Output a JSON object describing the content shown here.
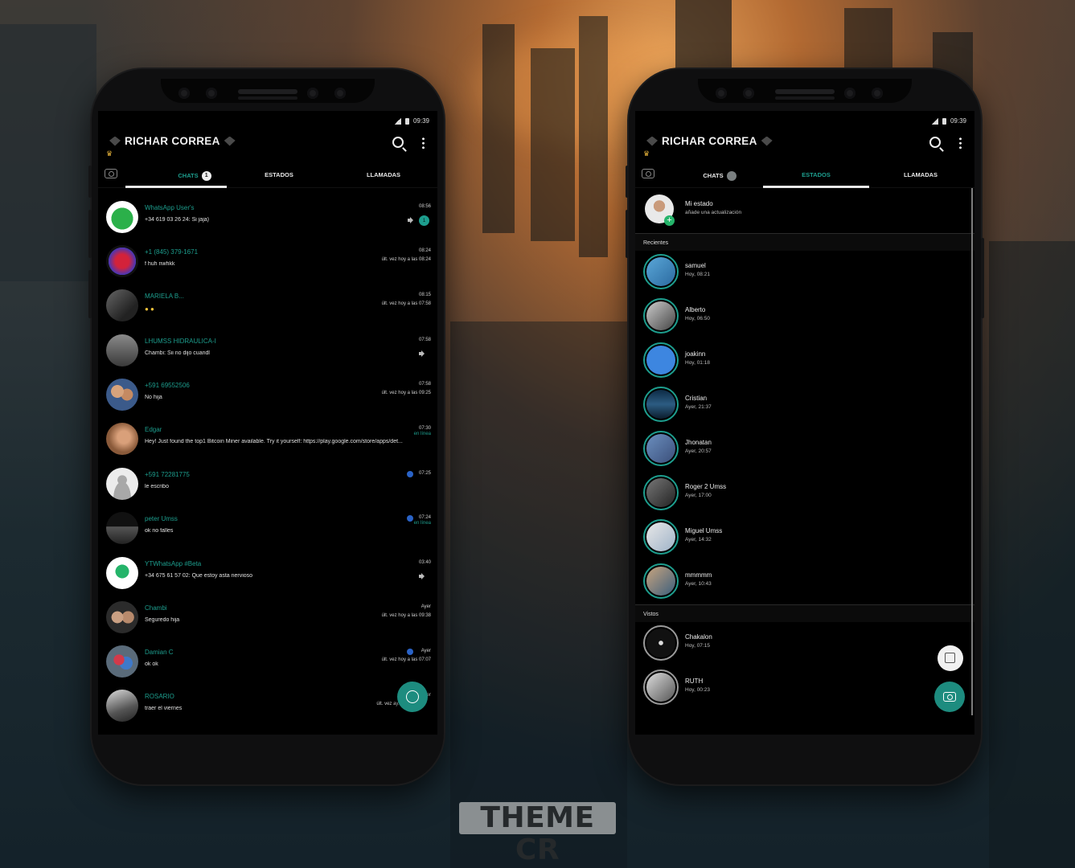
{
  "brand": {
    "logo_text": "THEME CR"
  },
  "phones": [
    {
      "status": {
        "time": "09:39"
      },
      "header": {
        "title": "RICHAR CORREA"
      },
      "tabs": [
        {
          "label": "CHATS",
          "badge": "1"
        },
        {
          "label": "ESTADOS"
        },
        {
          "label": "LLAMADAS"
        }
      ],
      "chats": [
        {
          "name": "WhatsApp User's",
          "msg": "+34 619 03 26 24: Si jaja)",
          "time": "08:56",
          "sub": "",
          "unread": "1"
        },
        {
          "name": "+1 (845) 379-1671",
          "msg": "f huh nwhkk",
          "time": "08:24",
          "sub": "últ. vez hoy a las 08:24"
        },
        {
          "name": "MARIELA B...",
          "msg": "",
          "time": "08:15",
          "sub": "últ. vez hoy a las 07:58"
        },
        {
          "name": "LHUMSS HIDRAULICA-I",
          "msg": "Chambi: Sii no dijo cuandl",
          "time": "07:58",
          "sub": ""
        },
        {
          "name": "+591 69552506",
          "msg": "No hija",
          "time": "07:58",
          "sub": "últ. vez hoy a las 09:25"
        },
        {
          "name": "Edgar",
          "msg": "Hey! Just found the top1 Bitcoin Miner available. Try it yourself: https://play.google.com/store/apps/det...",
          "time": "07:30",
          "sub": "en línea"
        },
        {
          "name": "+591 72281775",
          "msg": "le escribo",
          "time": "07:25",
          "sub": ""
        },
        {
          "name": "peter Umss",
          "msg": "ok no falles",
          "time": "07:24",
          "sub": "en línea"
        },
        {
          "name": "YTWhatsApp #Beta",
          "msg": "+34 675 61 57 02: Que estoy asta nervioso",
          "time": "03:40",
          "sub": ""
        },
        {
          "name": "Chambi",
          "msg": "Seguredo hija",
          "time": "Ayer",
          "sub": "últ. vez hoy a las 09:38"
        },
        {
          "name": "Damian C",
          "msg": "ok ok",
          "time": "Ayer",
          "sub": "últ. vez hoy a las 07:07"
        },
        {
          "name": "ROSARIO",
          "msg": "traer el viernes",
          "time": "Ayer",
          "sub": "últ. vez ay..."
        }
      ]
    },
    {
      "status": {
        "time": "09:39"
      },
      "header": {
        "title": "RICHAR CORREA"
      },
      "tabs": [
        {
          "label": "CHATS"
        },
        {
          "label": "ESTADOS"
        },
        {
          "label": "LLAMADAS"
        }
      ],
      "my_status": {
        "name": "Mi estado",
        "sub": "añade una actualización"
      },
      "recent_label": "Recientes",
      "recent": [
        {
          "name": "samuel",
          "time": "Hoy, 08:21"
        },
        {
          "name": "Alberto",
          "time": "Hoy, 06:50"
        },
        {
          "name": "joakinn",
          "time": "Hoy, 01:18"
        },
        {
          "name": "Cristian",
          "time": "Ayer, 21:37"
        },
        {
          "name": "Jhonatan",
          "time": "Ayer, 20:57"
        },
        {
          "name": "Roger 2 Umss",
          "time": "Ayer, 17:00"
        },
        {
          "name": "Miguel Umss",
          "time": "Ayer, 14:32"
        },
        {
          "name": "mmmmm",
          "time": "Ayer, 10:43"
        }
      ],
      "seen_label": "Vistos",
      "seen": [
        {
          "name": "Chakalon",
          "time": "Hoy, 07:15"
        },
        {
          "name": "RUTH",
          "time": "Hoy, 00:23"
        }
      ]
    }
  ],
  "colors": {
    "accent": "#1d9e8e",
    "background": "#000000"
  }
}
